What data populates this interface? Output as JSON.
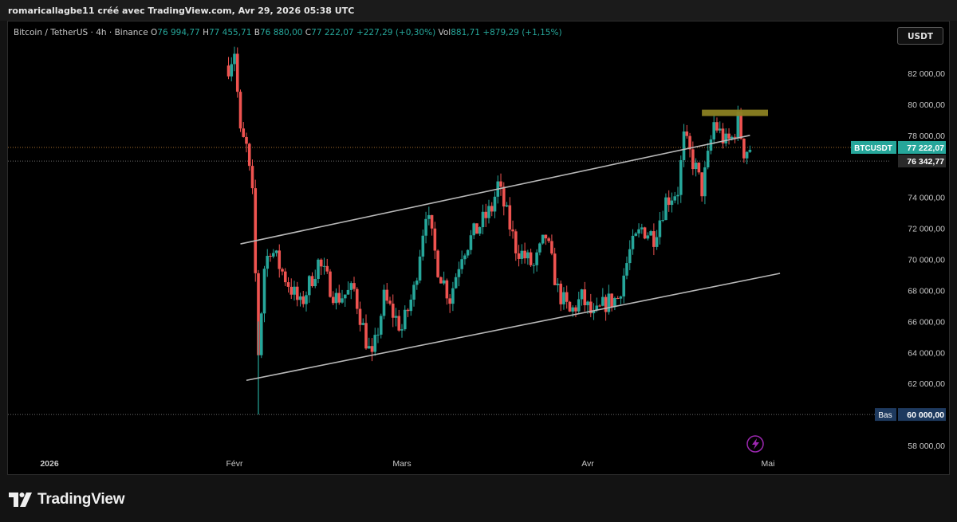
{
  "header": {
    "author_line": "romaricallagbe11 créé avec TradingView.com, Avr 29, 2026 05:38 UTC"
  },
  "legend": {
    "symbol": "Bitcoin / TetherUS · 4h · Binance",
    "o_label": "O",
    "o_value": "76 994,77",
    "h_label": "H",
    "h_value": "77 455,71",
    "b_label": "B",
    "b_value": "76 880,00",
    "c_label": "C",
    "c_value": "77 222,07",
    "change": "+227,29 (+0,30%)",
    "vol_label": "Vol",
    "vol_value": "881,71",
    "vol_change": "+879,29 (+1,15%)"
  },
  "currency_button": "USDT",
  "branding": {
    "logo_text": "TradingView",
    "logo_icon": "tradingview-logo-icon"
  },
  "colors": {
    "up": "#26a69a",
    "down": "#ef5350",
    "background": "#000000",
    "channel_line": "#b8b8b8",
    "resistance_box": "#8b8122",
    "price_label": "#26a69a",
    "low_label": "#1e3a5f",
    "lightning": "#9c27b0"
  },
  "chart_data": {
    "type": "candlestick",
    "symbol": "BTCUSDT",
    "timeframe": "4h",
    "y_axis": {
      "ylim": [
        57000,
        84500
      ],
      "ticks": [
        58000,
        62000,
        64000,
        66000,
        68000,
        70000,
        72000,
        74000,
        78000,
        80000,
        82000
      ],
      "tick_labels": [
        "58 000,00",
        "62 000,00",
        "64 000,00",
        "66 000,00",
        "68 000,00",
        "70 000,00",
        "72 000,00",
        "74 000,00",
        "78 000,00",
        "80 000,00",
        "82 000,00"
      ]
    },
    "x_axis": {
      "labels": [
        {
          "label": "2026",
          "date": "2026-01-01"
        },
        {
          "label": "Févr",
          "date": "2026-02-01"
        },
        {
          "label": "Mars",
          "date": "2026-03-01"
        },
        {
          "label": "Avr",
          "date": "2026-04-01"
        },
        {
          "label": "Mai",
          "date": "2026-05-01"
        }
      ]
    },
    "price_labels": {
      "symbol_tag": "BTCUSDT",
      "current": {
        "value": 77222.07,
        "text": "77 222,07"
      },
      "secondary": {
        "value": 76342.77,
        "text": "76 342,77"
      },
      "low": {
        "tag": "Bas",
        "value": 60000,
        "text": "60 000,00"
      }
    },
    "channel": {
      "upper": [
        {
          "date": "2026-02-02",
          "price": 71000
        },
        {
          "date": "2026-04-28",
          "price": 78000
        }
      ],
      "lower": [
        {
          "date": "2026-02-03",
          "price": 62200
        },
        {
          "date": "2026-05-03",
          "price": 69100
        }
      ]
    },
    "resistance_zone": {
      "from": "2026-04-20",
      "to": "2026-05-01",
      "low": 79200,
      "high": 79450
    },
    "close_path": [
      {
        "date": "2026-01-31",
        "price": 82500
      },
      {
        "date": "2026-02-01",
        "price": 83500
      },
      {
        "date": "2026-02-02",
        "price": 78000
      },
      {
        "date": "2026-02-03",
        "price": 77200
      },
      {
        "date": "2026-02-04",
        "price": 74000
      },
      {
        "date": "2026-02-05",
        "price": 64000
      },
      {
        "date": "2026-02-06",
        "price": 69500
      },
      {
        "date": "2026-02-07",
        "price": 70800
      },
      {
        "date": "2026-02-09",
        "price": 69200
      },
      {
        "date": "2026-02-12",
        "price": 67000
      },
      {
        "date": "2026-02-15",
        "price": 69800
      },
      {
        "date": "2026-02-18",
        "price": 67500
      },
      {
        "date": "2026-02-21",
        "price": 68000
      },
      {
        "date": "2026-02-23",
        "price": 64800
      },
      {
        "date": "2026-02-24",
        "price": 63500
      },
      {
        "date": "2026-02-26",
        "price": 67500
      },
      {
        "date": "2026-03-01",
        "price": 65500
      },
      {
        "date": "2026-03-03",
        "price": 68000
      },
      {
        "date": "2026-03-05",
        "price": 73200
      },
      {
        "date": "2026-03-07",
        "price": 69500
      },
      {
        "date": "2026-03-09",
        "price": 67500
      },
      {
        "date": "2026-03-11",
        "price": 70500
      },
      {
        "date": "2026-03-14",
        "price": 72200
      },
      {
        "date": "2026-03-16",
        "price": 73300
      },
      {
        "date": "2026-03-17",
        "price": 74800
      },
      {
        "date": "2026-03-18",
        "price": 73500
      },
      {
        "date": "2026-03-20",
        "price": 70800
      },
      {
        "date": "2026-03-23",
        "price": 69500
      },
      {
        "date": "2026-03-25",
        "price": 71500
      },
      {
        "date": "2026-03-27",
        "price": 68000
      },
      {
        "date": "2026-03-29",
        "price": 66500
      },
      {
        "date": "2026-03-31",
        "price": 67500
      },
      {
        "date": "2026-04-02",
        "price": 66200
      },
      {
        "date": "2026-04-04",
        "price": 67200
      },
      {
        "date": "2026-04-06",
        "price": 67500
      },
      {
        "date": "2026-04-08",
        "price": 70500
      },
      {
        "date": "2026-04-10",
        "price": 72000
      },
      {
        "date": "2026-04-12",
        "price": 71500
      },
      {
        "date": "2026-04-14",
        "price": 73800
      },
      {
        "date": "2026-04-16",
        "price": 74500
      },
      {
        "date": "2026-04-17",
        "price": 77800
      },
      {
        "date": "2026-04-19",
        "price": 75800
      },
      {
        "date": "2026-04-20",
        "price": 74500
      },
      {
        "date": "2026-04-21",
        "price": 76500
      },
      {
        "date": "2026-04-22",
        "price": 78800
      },
      {
        "date": "2026-04-24",
        "price": 77500
      },
      {
        "date": "2026-04-25",
        "price": 77800
      },
      {
        "date": "2026-04-26",
        "price": 79000
      },
      {
        "date": "2026-04-27",
        "price": 77000
      },
      {
        "date": "2026-04-28",
        "price": 77200
      }
    ]
  }
}
